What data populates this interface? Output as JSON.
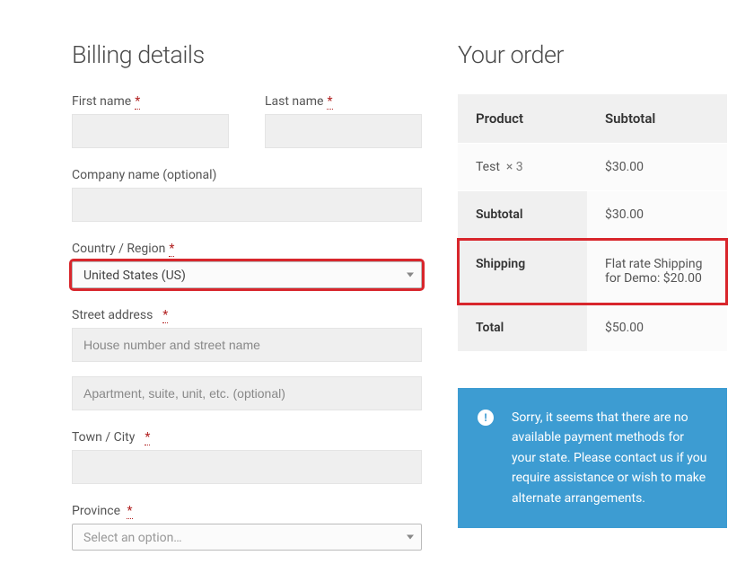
{
  "billing": {
    "title": "Billing details",
    "first_name": {
      "label": "First name",
      "value": ""
    },
    "last_name": {
      "label": "Last name",
      "value": ""
    },
    "company": {
      "label": "Company name (optional)",
      "value": ""
    },
    "country": {
      "label": "Country / Region",
      "value": "United States (US)"
    },
    "street_label": "Street address",
    "street1": {
      "placeholder": "House number and street name",
      "value": ""
    },
    "street2": {
      "placeholder": "Apartment, suite, unit, etc. (optional)",
      "value": ""
    },
    "city": {
      "label": "Town / City",
      "value": ""
    },
    "province": {
      "label": "Province",
      "value": "Select an option…"
    },
    "required_marker": "*"
  },
  "order": {
    "title": "Your order",
    "headers": {
      "product": "Product",
      "subtotal": "Subtotal"
    },
    "item": {
      "name": "Test",
      "qty_prefix": "× 3",
      "line_total": "$30.00"
    },
    "subtotal": {
      "label": "Subtotal",
      "value": "$30.00"
    },
    "shipping": {
      "label": "Shipping",
      "line1": "Flat rate Shipping",
      "line2": "for Demo: $20.00"
    },
    "total": {
      "label": "Total",
      "value": "$50.00"
    }
  },
  "notice": {
    "text": "Sorry, it seems that there are no available payment methods for your state. Please contact us if you require assistance or wish to make alternate arrangements."
  }
}
